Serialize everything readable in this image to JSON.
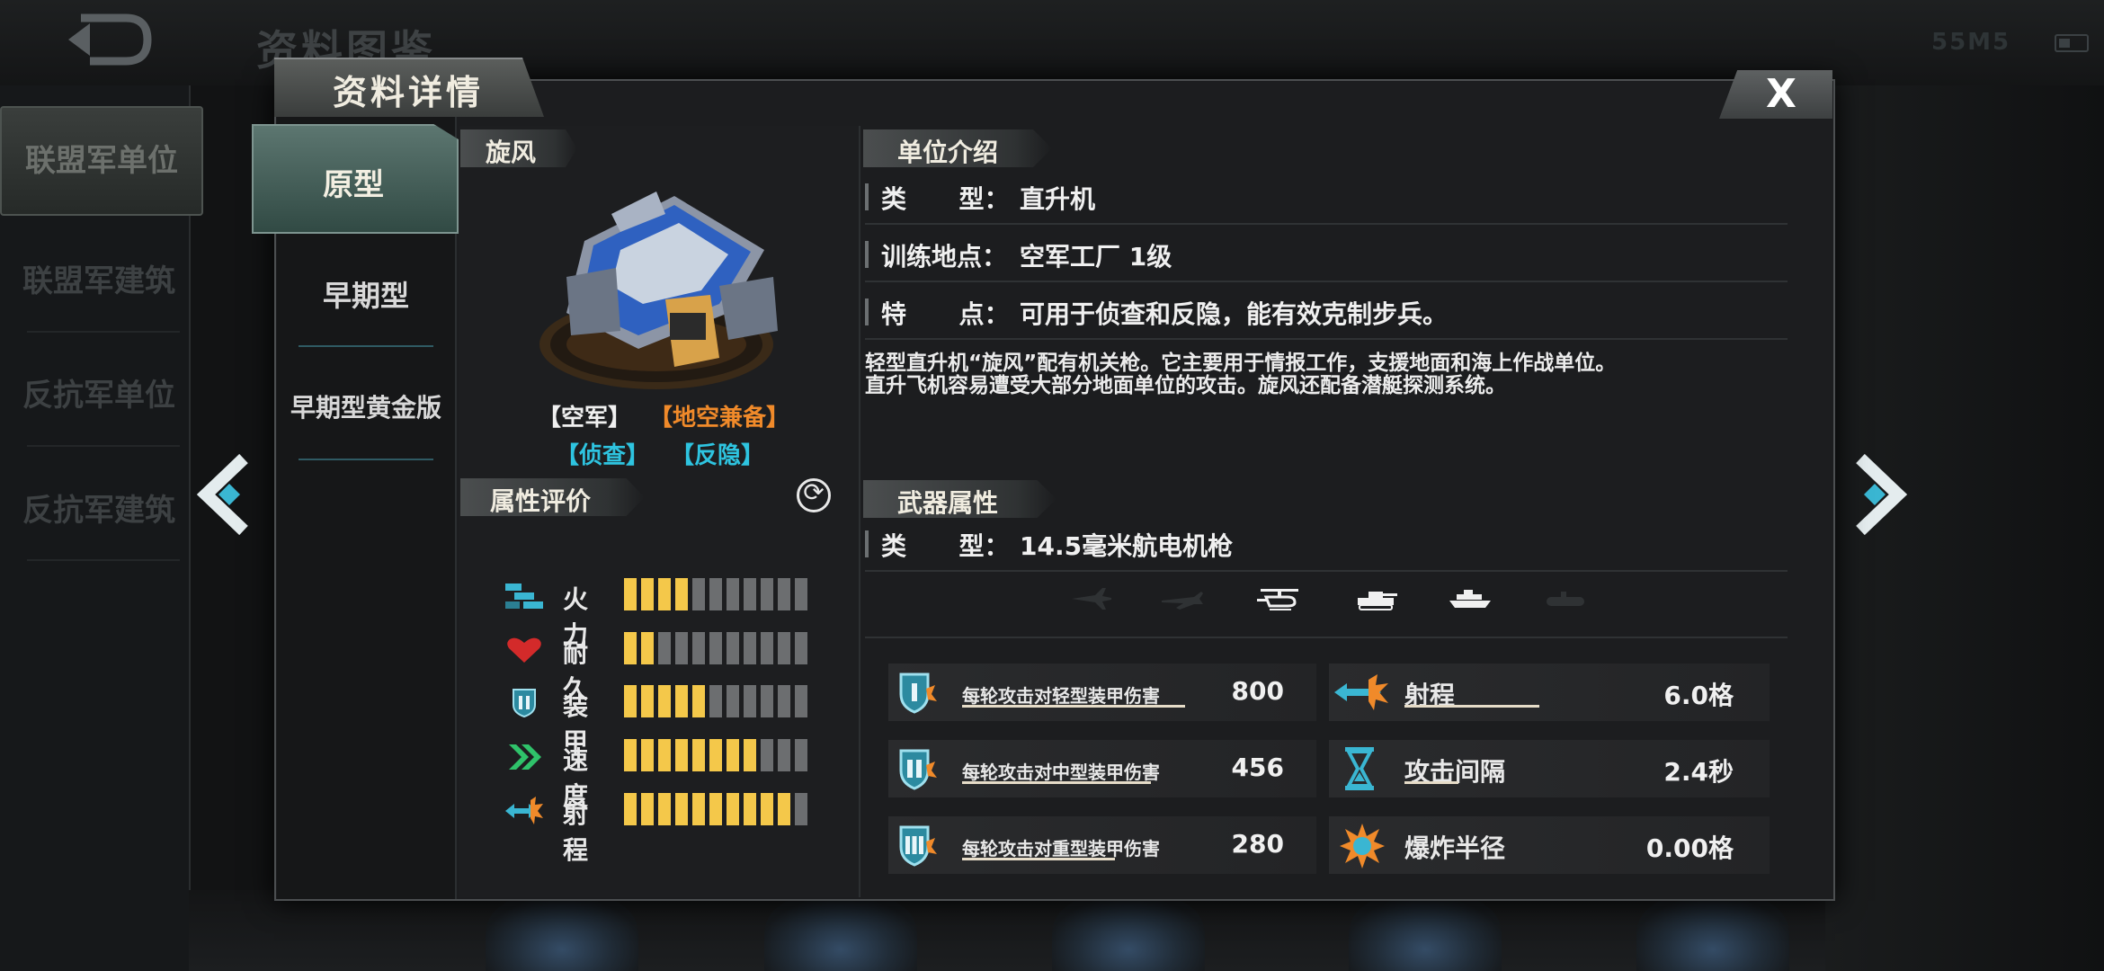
{
  "background": {
    "title": "资料图鉴",
    "status": "55M5",
    "side_items": [
      "联盟军单位",
      "联盟军建筑",
      "反抗军单位",
      "反抗军建筑"
    ]
  },
  "dialog": {
    "title": "资料详情",
    "close_label": "X"
  },
  "variant_tabs": {
    "active": "原型",
    "items": [
      "早期型",
      "早期型黄金版"
    ]
  },
  "unit": {
    "name": "旋风",
    "tags_row1": [
      "【空军】",
      "【地空兼备】"
    ],
    "tags_row2": [
      "【侦查】",
      "【反隐】"
    ]
  },
  "attributes": {
    "header": "属性评价",
    "items": [
      {
        "label": "火力",
        "icon": "firepower-icon",
        "value": 4,
        "max": 11
      },
      {
        "label": "耐久",
        "icon": "heart-icon",
        "value": 2,
        "max": 11
      },
      {
        "label": "装甲",
        "icon": "armor-shield-icon",
        "value": 5,
        "max": 11
      },
      {
        "label": "速度",
        "icon": "speed-chevron-icon",
        "value": 8,
        "max": 11
      },
      {
        "label": "射程",
        "icon": "range-arrow-icon",
        "value": 10,
        "max": 11
      }
    ]
  },
  "intro": {
    "header": "单位介绍",
    "rows": [
      {
        "label": "类      型：",
        "value": "直升机"
      },
      {
        "label": "训练地点：",
        "value": "空军工厂 1级"
      },
      {
        "label": "特      点：",
        "value": "可用于侦查和反隐，能有效克制步兵。"
      }
    ],
    "desc_line1": "轻型直升机“旋风”配有机关枪。它主要用于情报工作，支援地面和海上作战单位。",
    "desc_line2": "直升飞机容易遭受大部分地面单位的攻击。旋风还配备潜艇探测系统。"
  },
  "weapon": {
    "header": "武器属性",
    "type_label": "类      型：",
    "type_value": "14.5毫米航电机枪",
    "targets": [
      {
        "icon": "fighter-jet-icon",
        "active": false
      },
      {
        "icon": "bomber-icon",
        "active": false
      },
      {
        "icon": "helicopter-icon",
        "active": true
      },
      {
        "icon": "tank-icon",
        "active": true
      },
      {
        "icon": "ship-icon",
        "active": true
      },
      {
        "icon": "submarine-icon",
        "active": false
      }
    ],
    "rows": [
      {
        "label": "每轮攻击对轻型装甲伤害",
        "value": "800",
        "stat_label": "射程",
        "stat_value": "6.0格"
      },
      {
        "label": "每轮攻击对中型装甲伤害",
        "value": "456",
        "stat_label": "攻击间隔",
        "stat_value": "2.4秒"
      },
      {
        "label": "每轮攻击对重型装甲伤害",
        "value": "280",
        "stat_label": "爆炸半径",
        "stat_value": "0.00格"
      }
    ]
  },
  "colors": {
    "accent_gold": "#f4c84a",
    "tag_orange": "#f08a2a",
    "tag_cyan": "#2ec4e0",
    "teal_tab": "#3e5a54"
  }
}
